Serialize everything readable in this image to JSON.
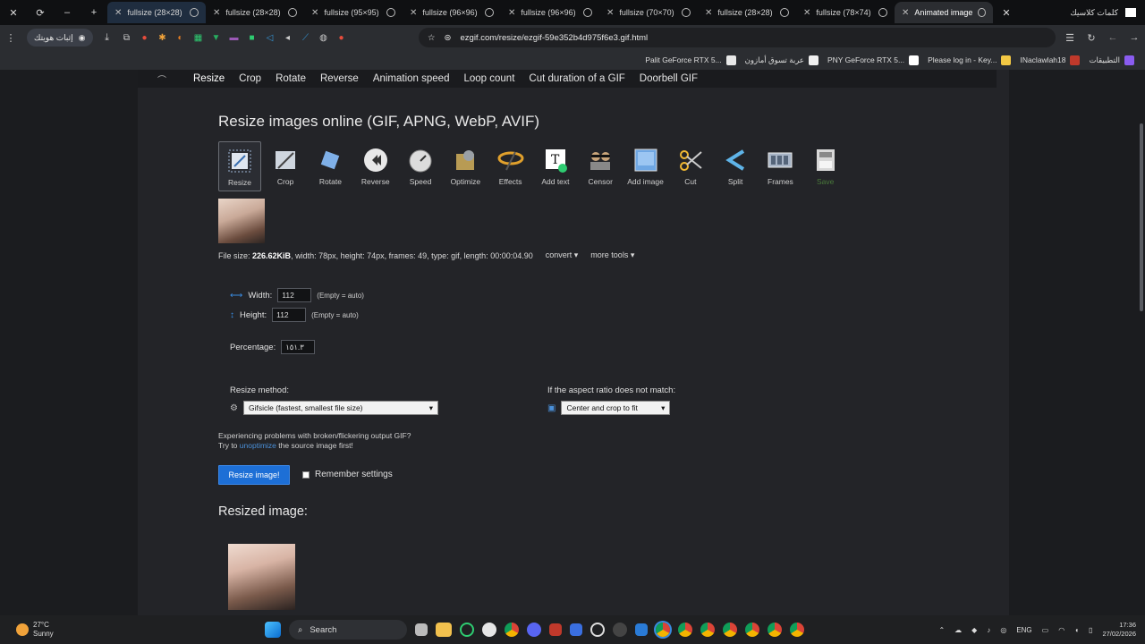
{
  "tabs": [
    {
      "label": "fullsize (28×28)"
    },
    {
      "label": "fullsize (28×28)"
    },
    {
      "label": "fullsize (95×95)"
    },
    {
      "label": "fullsize (96×96)"
    },
    {
      "label": "fullsize (96×96)"
    },
    {
      "label": "fullsize (70×70)"
    },
    {
      "label": "fullsize (28×28)"
    },
    {
      "label": "fullsize (78×74)"
    },
    {
      "label": "Animated image"
    }
  ],
  "tab_arabic": "كلمات كلاسيك",
  "toolbar": {
    "profile_label": "إثبات هويتك",
    "url": "ezgif.com/resize/ezgif-59e352b4d975f6e3.gif.html"
  },
  "bookmarks": [
    {
      "label": "Palit GeForce RTX 5...",
      "color": "#e8e8e8"
    },
    {
      "label": "عربة تسوق أمازون",
      "color": "#f0f0f0"
    },
    {
      "label": "PNY GeForce RTX 5...",
      "color": "#ffffff"
    },
    {
      "label": "Please log in - Key...",
      "color": "#f3c844"
    },
    {
      "label": "INaclawlah18",
      "color": "#c0392b"
    },
    {
      "label": "التطبيقات",
      "color": "#8a5cf0"
    }
  ],
  "nav": {
    "links": [
      "Resize",
      "Crop",
      "Rotate",
      "Reverse",
      "Animation speed",
      "Loop count",
      "Cut duration of a GIF",
      "Doorbell GIF"
    ]
  },
  "page": {
    "title": "Resize images online (GIF, APNG, WebP, AVIF)",
    "tools": [
      {
        "label": "Resize",
        "icon": "resize-icon",
        "color": "#dfe6ef"
      },
      {
        "label": "Crop",
        "icon": "crop-icon",
        "color": "#cfd6df"
      },
      {
        "label": "Rotate",
        "icon": "rotate-icon",
        "color": "#7fb0e8"
      },
      {
        "label": "Reverse",
        "icon": "reverse-icon",
        "color": "#e8e8e8"
      },
      {
        "label": "Speed",
        "icon": "speed-icon",
        "color": "#dcdcdc"
      },
      {
        "label": "Optimize",
        "icon": "optimize-icon",
        "color": "#b89b54"
      },
      {
        "label": "Effects",
        "icon": "effects-icon",
        "color": "#e0a02c"
      },
      {
        "label": "Add text",
        "icon": "add-text-icon",
        "color": "#ffffff"
      },
      {
        "label": "Censor",
        "icon": "censor-icon",
        "color": "#c9a57a"
      },
      {
        "label": "Add image",
        "icon": "add-image-icon",
        "color": "#6fa7e3"
      },
      {
        "label": "Cut",
        "icon": "cut-icon",
        "color": "#f0b832"
      },
      {
        "label": "Split",
        "icon": "split-icon",
        "color": "#5fb4e8"
      },
      {
        "label": "Frames",
        "icon": "frames-icon",
        "color": "#a7b4c6"
      },
      {
        "label": "Save",
        "icon": "save-icon",
        "color": "#d8d8d8"
      }
    ],
    "file_info_label": "File size:",
    "file_size": "226.62KiB",
    "file_info_rest": ", width: 78px, height: 74px, frames: 49, type: gif, length: 00:00:04.90",
    "convert_label": "convert ▾",
    "more_tools_label": "more tools ▾",
    "width_label": "Width:",
    "width_value": "112",
    "height_label": "Height:",
    "height_value": "112",
    "empty_hint": "(Empty = auto)",
    "percentage_label": "Percentage:",
    "percentage_value": "١٥١.٣",
    "method_label": "Resize method:",
    "method_value": "Gifsicle (fastest, smallest file size)",
    "aspect_label": "If the aspect ratio does not match:",
    "aspect_value": "Center and crop to fit",
    "warn_line1": "Experiencing problems with broken/flickering output GIF?",
    "warn_try": "Try to",
    "warn_link": "unoptimize",
    "warn_rest": "the source image first!",
    "resize_button": "Resize image!",
    "remember_label": "Remember settings",
    "resized_heading": "Resized image:"
  },
  "taskbar": {
    "temp": "27°C",
    "weather": "Sunny",
    "search_placeholder": "Search",
    "lang": "ENG",
    "time": "17:36",
    "date": "27/02/2026"
  }
}
